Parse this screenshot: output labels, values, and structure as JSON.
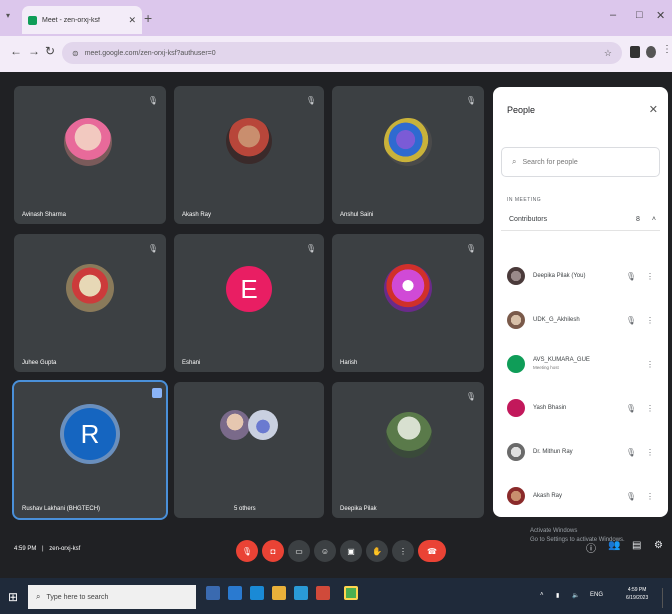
{
  "browser": {
    "tab_title": "Meet - zen-orxj-ksf",
    "url": "meet.google.com/zen-orxj-ksf?authuser=0",
    "icons": [
      "tab-menu-icon",
      "close-icon",
      "new-tab-icon",
      "minimize-icon",
      "maximize-icon",
      "close-window-icon",
      "back-icon",
      "forward-icon",
      "reload-icon",
      "site-info-icon",
      "bookmark-star-icon"
    ]
  },
  "tiles": [
    {
      "name": "Avinash Sharma"
    },
    {
      "name": "Akash Ray"
    },
    {
      "name": "Anshul Saini"
    },
    {
      "name": "Juhee Gupta"
    },
    {
      "name": "Eshani",
      "letter": "E"
    },
    {
      "name": "Harish"
    },
    {
      "name": "Rushav Lakhani (BHGTECH)",
      "letter": "R"
    },
    {
      "name": "5 others"
    },
    {
      "name": "Deepika Pilak"
    }
  ],
  "people": {
    "title": "People",
    "search_placeholder": "Search for people",
    "section_label": "IN MEETING",
    "group_label": "Contributors",
    "group_count": "8",
    "participants": [
      {
        "name": "Deepika Pilak (You)",
        "sub": ""
      },
      {
        "name": "UDK_G_Akhilesh",
        "sub": ""
      },
      {
        "name": "AVS_KUMARA_GUE",
        "sub": "Meeting host"
      },
      {
        "name": "Yash Bhasin",
        "sub": ""
      },
      {
        "name": "Dr. Mithun Ray",
        "sub": ""
      },
      {
        "name": "Akash Ray",
        "sub": ""
      }
    ]
  },
  "bottom": {
    "time": "4:59 PM",
    "meeting_code": "zen-orxj-ksf",
    "activate_line1": "Activate Windows",
    "activate_line2": "Go to Settings to activate Windows."
  },
  "taskbar": {
    "search_placeholder": "Type here to search",
    "clock_time": "4:59 PM",
    "clock_date": "6/19/2023",
    "tray_lang": "ENG"
  },
  "colors": {
    "accent_red": "#ea4335",
    "meet_bg": "#202124",
    "tile_bg": "#3c4043",
    "tab_strip": "#dcc7ec",
    "letter_e": "#e91e63",
    "letter_r": "#1565c0"
  }
}
